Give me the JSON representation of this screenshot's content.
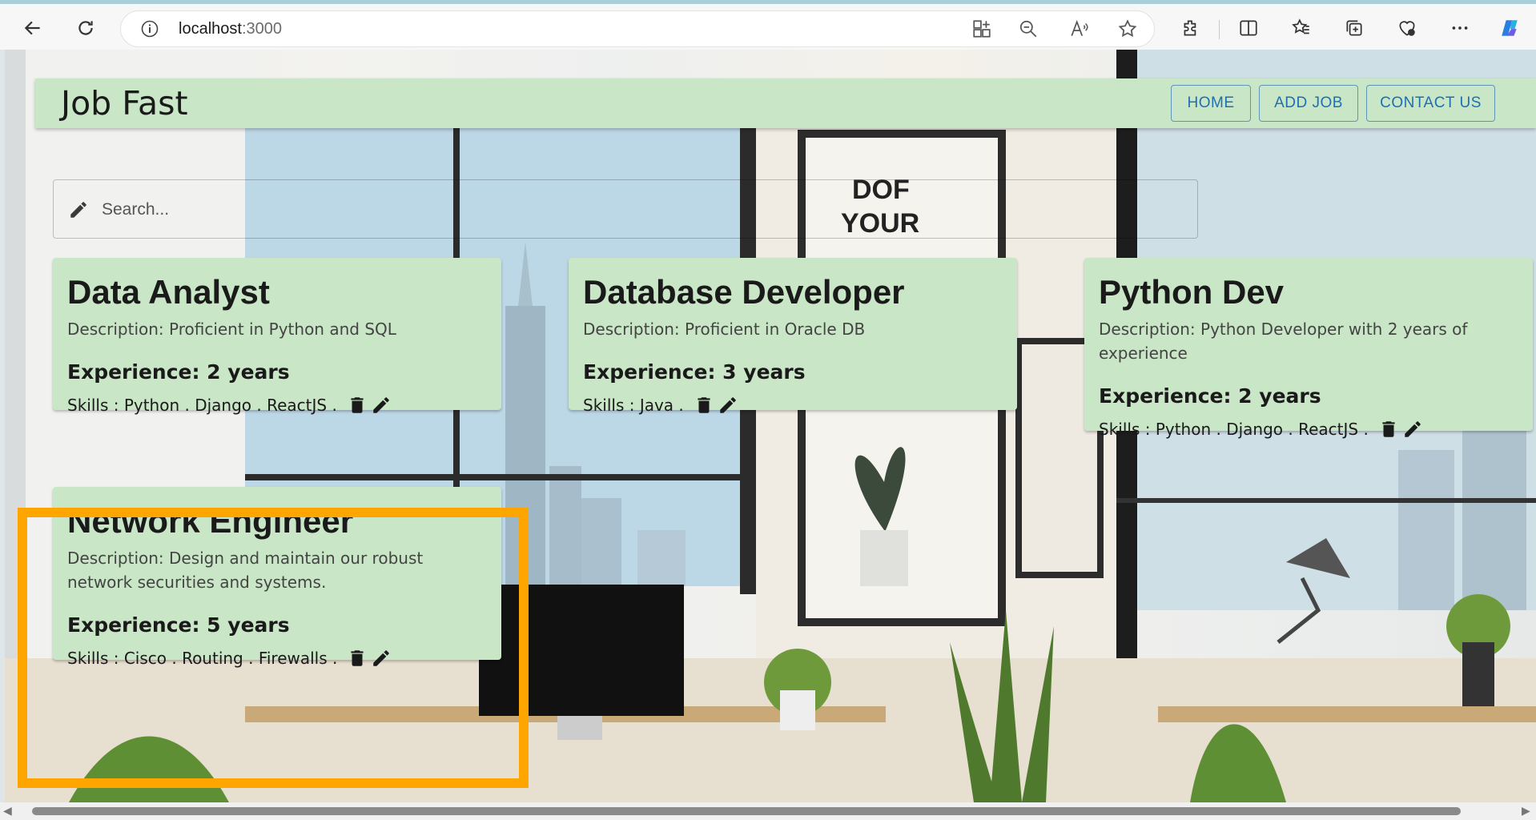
{
  "browser": {
    "url_host": "localhost",
    "url_port": ":3000"
  },
  "app": {
    "brand": "Job Fast",
    "nav": {
      "home": "HOME",
      "add_job": "ADD JOB",
      "contact_us": "CONTACT US"
    },
    "search": {
      "placeholder": "Search..."
    }
  },
  "background_poster_text": {
    "line1": "DOF",
    "line2": "YOUR"
  },
  "jobs": [
    {
      "title": "Data Analyst",
      "description": "Description: Proficient in Python and SQL",
      "experience": "Experience: 2 years",
      "skills": "Skills : Python . Django . ReactJS ."
    },
    {
      "title": "Database Developer",
      "description": "Description: Proficient in Oracle DB",
      "experience": "Experience: 3 years",
      "skills": "Skills : Java ."
    },
    {
      "title": "Python Dev",
      "description": "Description: Python Developer with 2 years of experience",
      "experience": "Experience: 2 years",
      "skills": "Skills : Python . Django . ReactJS ."
    },
    {
      "title": "Network Engineer",
      "description": "Description: Design and maintain our robust network securities and systems.",
      "experience": "Experience: 5 years",
      "skills": "Skills : Cisco . Routing . Firewalls ."
    }
  ],
  "colors": {
    "card_bg": "#c9e6c6",
    "nav_button": "#1f6fb3",
    "highlight": "#ffa500"
  }
}
